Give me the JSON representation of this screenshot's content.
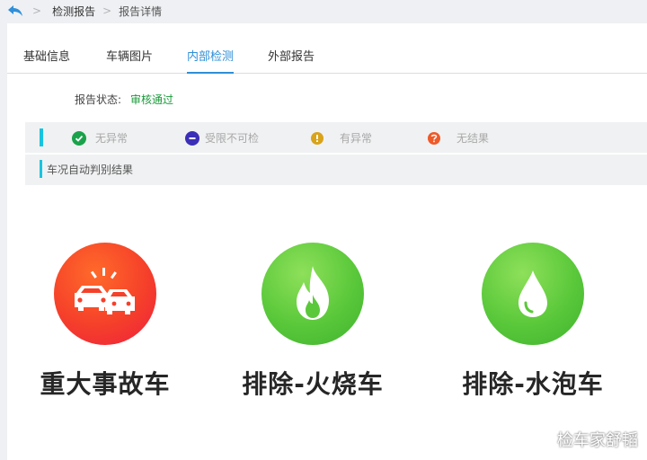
{
  "breadcrumb": {
    "items": [
      "检测报告",
      "报告详情"
    ],
    "separator": ">"
  },
  "tabs": [
    {
      "label": "基础信息",
      "active": false
    },
    {
      "label": "车辆图片",
      "active": false
    },
    {
      "label": "内部检测",
      "active": true
    },
    {
      "label": "外部报告",
      "active": false
    }
  ],
  "report": {
    "status_label": "报告状态:",
    "status_value": "审核通过"
  },
  "legend": [
    {
      "label": "无异常",
      "icon": "check-circle-icon",
      "color": "#1aa24a"
    },
    {
      "label": "受限不可检",
      "icon": "minus-circle-icon",
      "color": "#3b2fb8"
    },
    {
      "label": "有异常",
      "icon": "exclamation-circle-icon",
      "color": "#d9a31a"
    },
    {
      "label": "无结果",
      "icon": "question-circle-icon",
      "color": "#ee5a2a"
    }
  ],
  "result_section_title": "车况自动判别结果",
  "results": [
    {
      "label": "重大事故车",
      "icon": "car-crash-icon",
      "color": "#f5402a"
    },
    {
      "label": "排除-火烧车",
      "icon": "fire-icon",
      "color": "#5ac83a"
    },
    {
      "label": "排除-水泡车",
      "icon": "water-drop-icon",
      "color": "#5ac83a"
    }
  ],
  "watermark": "检车家舒韬"
}
